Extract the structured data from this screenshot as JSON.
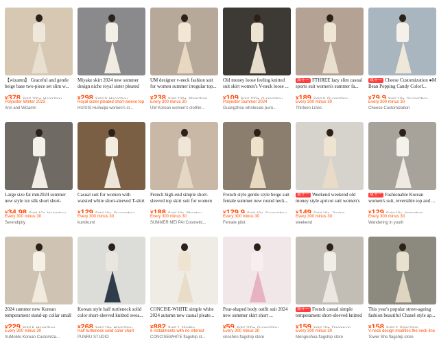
{
  "colors": {
    "price": "#ff4400",
    "promo": "#ff5000",
    "tag_bg": "#ff3d3d"
  },
  "tag_label": "双十一",
  "products": [
    {
      "title": "【wizamn】 Graceful and gentle beige base two-piece set slim w...",
      "price": "378",
      "sold": "Sold 100+",
      "location": "Hangzhou",
      "promo": "Polyester Winter 2023",
      "store": "Ann and Wizamn",
      "tag": false,
      "bg": "#d7c8b4",
      "top": "#efe7d9",
      "skirt": "#e8dfd0"
    },
    {
      "title": "Miyake skirt 2024 new summer design niche royal sister pleated s...",
      "price": "298",
      "sold": "Sold 9",
      "location": "Hangzhou",
      "promo": "Royal sister pleated short-sleeve top",
      "store": "HUIXIS Huihuijia women's cl...",
      "tag": false,
      "bg": "#8a8a8c",
      "top": "#f3efe6",
      "skirt": "#f1ece2"
    },
    {
      "title": "UM designer v-neck fashion suit for women summer irregular top...",
      "price": "238",
      "sold": "Sold 100+",
      "location": "Shenzhen",
      "promo": "Every 300 minus 30",
      "store": "UM Korean women's clothin...",
      "tag": false,
      "bg": "#b7a99a",
      "top": "#f2e6d4",
      "skirt": "#e9d8c1"
    },
    {
      "title": "Old money loose feeling knitted suit skirt women's V-neck loose ...",
      "price": "109",
      "sold": "Sold 100+",
      "location": "Guangzhou",
      "promo": "Polyester Summer 2024",
      "store": "Guangzhou wholesale puro...",
      "tag": false,
      "bg": "#3d3a36",
      "top": "#ece3d2",
      "skirt": "#e6dccb"
    },
    {
      "title": "FTHREE lazy slim casual sports suit women's summer fa...",
      "price": "189",
      "sold": "Sold 9",
      "location": "Guangzhou",
      "promo": "Every 300 minus 30",
      "store": "Thirteen Lines",
      "tag": true,
      "bg": "#b4a394",
      "top": "#f0e6d6",
      "skirt": "#e9dfcf"
    },
    {
      "title": "Cheese Customization ●M Bean Popping Candy Colorf...",
      "price": "79.9",
      "sold": "Sold 10+",
      "location": "Guangzhou",
      "promo": "Every 300 minus 30",
      "store": "Cheese Customization",
      "tag": true,
      "bg": "#a9b6c0",
      "top": "#f6f1e8",
      "skirt": "#efe7da"
    },
    {
      "title": "Large size fat mm2024 summer new style ice silk short short-sleev...",
      "price": "34.98",
      "sold": "Sold 10+",
      "location": "Hangzhou",
      "promo": "Every 300 minus 30",
      "store": "Serendipity",
      "tag": false,
      "bg": "#6f6a64",
      "top": "#f4f1ea",
      "skirt": "#f1ede5"
    },
    {
      "title": "Casual suit for women with waisted white short-sleeved T-shirt for...",
      "price": "129",
      "sold": "Sold 10+",
      "location": "Guangzhou",
      "promo": "Every 300 minus 30",
      "store": "kumikumi",
      "tag": false,
      "bg": "#7a5f45",
      "top": "#f2ece1",
      "skirt": "#ede5d8"
    },
    {
      "title": "French high-end simple short-sleeved top skirt suit for women su...",
      "price": "188",
      "sold": "Sold 10+",
      "location": "Shantou",
      "promo": "Every 300 minus 30",
      "store": "SUMMER MEI PAI Cosmetic...",
      "tag": false,
      "bg": "#c9b8a6",
      "top": "#efe6d8",
      "skirt": "#e4d8c5"
    },
    {
      "title": "French style gentle style beige suit female summer new round neck...",
      "price": "129.9",
      "sold": "Sold 10+",
      "location": "Guangzhou",
      "promo": "Every 300 minus 30",
      "store": "Female pilot",
      "tag": false,
      "bg": "#8b7e6f",
      "top": "#efe2cb",
      "skirt": "#e7d8bf"
    },
    {
      "title": "Weekend weekend old money style apricot suit women's su...",
      "price": "149",
      "sold": "Sold 10+",
      "location": "Jiaxing",
      "promo": "Every 300 minus 30",
      "store": "weekend",
      "tag": true,
      "bg": "#d6d3cd",
      "top": "#efe4d1",
      "skirt": "#e8dcc8"
    },
    {
      "title": "Fashionable Korean women's suit, reversible top and ...",
      "price": "129",
      "sold": "Sold 10+",
      "location": "Hangzhou",
      "promo": "Every 300 minus 30",
      "store": "Wandering in youth",
      "tag": true,
      "bg": "#a7a29a",
      "top": "#f5f2ec",
      "skirt": "#eeeae3"
    },
    {
      "title": "2024 summer new Korean temperament stand-up collar small flyi...",
      "price": "229",
      "sold": "Sold 5",
      "location": "Hangzhou",
      "promo": "Every 300 minus 30",
      "store": "XuMoMo Korean Customiza...",
      "tag": false,
      "bg": "#cfc3b3",
      "top": "#f6f1e6",
      "skirt": "#f1ebdf"
    },
    {
      "title": "Korean style half turtleneck solid color short-sleeved knitted swea...",
      "price": "268",
      "sold": "Sold 10+",
      "location": "Hangzhou",
      "promo": "Half turtleneck solid color short",
      "store": "PUNRU STUDIO",
      "tag": false,
      "bg": "#dcdcd8",
      "top": "#e9e6df",
      "skirt": "#2f3c4a"
    },
    {
      "title": "CONCISE-WHITE simple white 2024 autumn new casual pleate...",
      "price": "882",
      "sold": "Sold 1",
      "location": "Ningbo",
      "promo": "6 installments with no interest",
      "store": "CONCISEWHITE flagship st...",
      "tag": false,
      "bg": "#efece6",
      "top": "#efe4d2",
      "skirt": "#e9ddc9"
    },
    {
      "title": "Pear-shaped body outfit suit 2024 new summer skirt short ...",
      "price": "59",
      "sold": "Sold 100+",
      "location": "Guangzhou",
      "promo": "Every 300 minus 30",
      "store": "ciroshiro flagship store",
      "tag": false,
      "bg": "#f1e6e8",
      "top": "#f7eef0",
      "skirt": "#e7b3c0"
    },
    {
      "title": "French casual simple temperament short-sleeved knitted T-...",
      "price": "159",
      "sold": "Sold 10+",
      "location": "Dongguan",
      "promo": "Every 300 minus 30",
      "store": "Mengruihua flagship store",
      "tag": true,
      "bg": "#c2bdb5",
      "top": "#f1eee8",
      "skirt": "#ece8e1"
    },
    {
      "title": "This year's popular street-ageing fashion beautiful Chanel style ap...",
      "price": "158",
      "sold": "Sold 3",
      "location": "Shenzhen",
      "promo": "V-neck design modifies the neck line",
      "store": "Tower She flagship store",
      "tag": false,
      "bg": "#8c8a7f",
      "top": "#e8e1cf",
      "skirt": "#dfd6c1"
    }
  ]
}
